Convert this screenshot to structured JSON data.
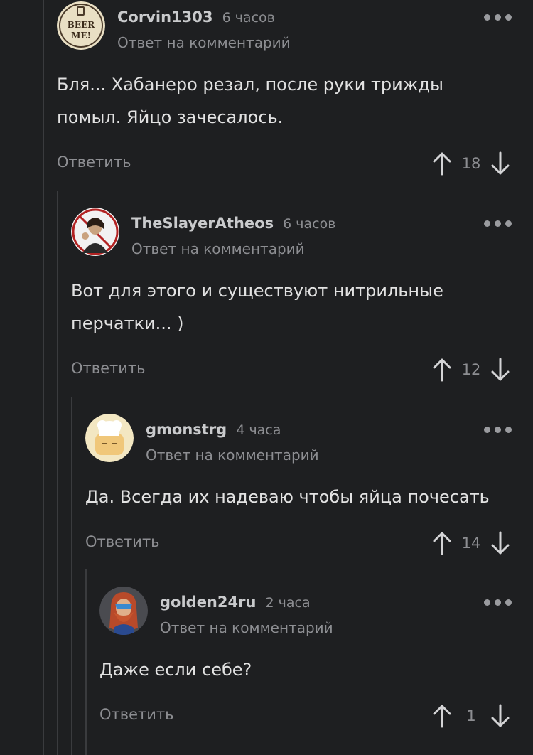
{
  "comments": [
    {
      "username": "Corvin1303",
      "time": "6 часов",
      "subline": "Ответ на комментарий",
      "text": "Бля... Хабанеро резал, после руки трижды помыл. Яйцо зачесалось.",
      "reply_label": "Ответить",
      "rating": "18",
      "avatar_text": "BEER ME!"
    },
    {
      "username": "TheSlayerAtheos",
      "time": "6 часов",
      "subline": "Ответ на комментарий",
      "text": "Вот для этого и существуют нитрильные перчатки... )",
      "reply_label": "Ответить",
      "rating": "12"
    },
    {
      "username": "gmonstrg",
      "time": "4 часа",
      "subline": "Ответ на комментарий",
      "text": "Да. Всегда их надеваю чтобы яйца почесать",
      "reply_label": "Ответить",
      "rating": "14"
    },
    {
      "username": "golden24ru",
      "time": "2 часа",
      "subline": "Ответ на комментарий",
      "text": "Даже если себе?",
      "reply_label": "Ответить",
      "rating": "1"
    }
  ]
}
